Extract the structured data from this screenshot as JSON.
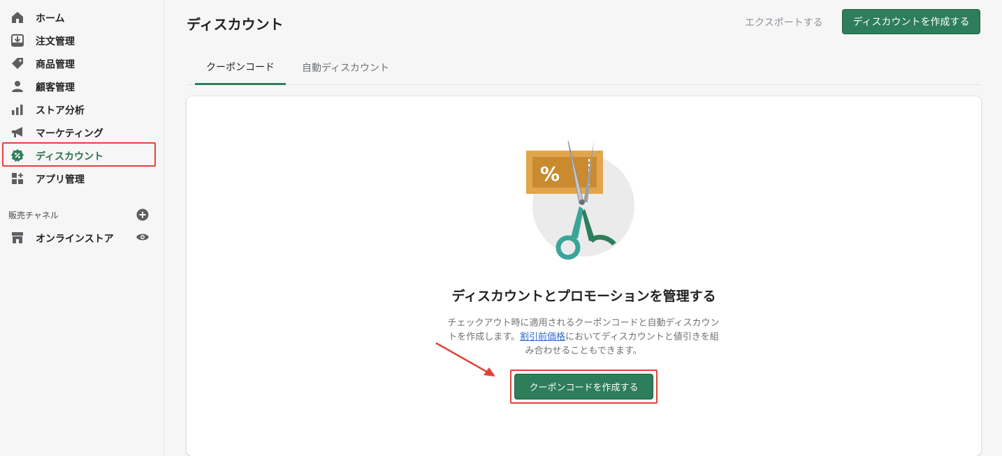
{
  "sidebar": {
    "items": [
      {
        "label": "ホーム",
        "icon": "home-icon"
      },
      {
        "label": "注文管理",
        "icon": "orders-icon"
      },
      {
        "label": "商品管理",
        "icon": "tag-icon"
      },
      {
        "label": "顧客管理",
        "icon": "customer-icon"
      },
      {
        "label": "ストア分析",
        "icon": "analytics-icon"
      },
      {
        "label": "マーケティング",
        "icon": "megaphone-icon"
      },
      {
        "label": "ディスカウント",
        "icon": "discount-icon",
        "active": true
      },
      {
        "label": "アプリ管理",
        "icon": "apps-icon"
      }
    ],
    "sales_channels_title": "販売チャネル",
    "channels": [
      {
        "label": "オンラインストア",
        "icon": "store-icon"
      }
    ]
  },
  "header": {
    "title": "ディスカウント",
    "export_label": "エクスポートする",
    "create_label": "ディスカウントを作成する"
  },
  "tabs": [
    {
      "label": "クーポンコード",
      "active": true
    },
    {
      "label": "自動ディスカウント",
      "active": false
    }
  ],
  "empty_state": {
    "heading": "ディスカウントとプロモーションを管理する",
    "desc_part1": "チェックアウト時に適用されるクーポンコードと自動ディスカウントを作成します。",
    "desc_link": "割引前価格",
    "desc_part2": "においてディスカウントと値引きを組み合わせることもできます。",
    "cta_label": "クーポンコードを作成する",
    "illustration_symbol": "%"
  },
  "colors": {
    "accent": "#2e7d5b",
    "annotation": "#e0433a",
    "link": "#2c6ecb"
  }
}
